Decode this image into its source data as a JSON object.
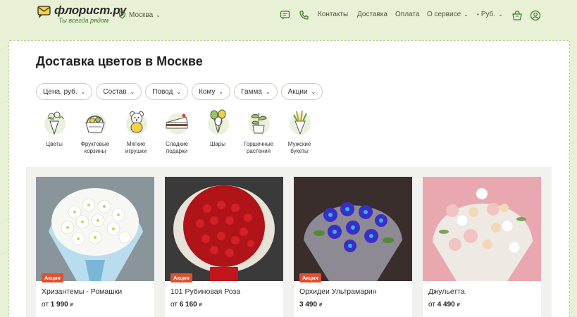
{
  "header": {
    "logo_name": "флорист.ру",
    "logo_tagline": "Ты всегда рядом",
    "city": "Москва",
    "nav": [
      "Контакты",
      "Доставка",
      "Оплата",
      "О сервисе"
    ],
    "currency": "Руб."
  },
  "page_title": "Доставка цветов в Москве",
  "filters": [
    "Цена, руб.",
    "Состав",
    "Повод",
    "Кому",
    "Гамма",
    "Акции"
  ],
  "categories": [
    {
      "label": "Цветы",
      "icon": "bouquet-icon"
    },
    {
      "label": "Фруктовые корзины",
      "icon": "fruit-basket-icon"
    },
    {
      "label": "Мягкие игрушки",
      "icon": "teddy-bear-icon"
    },
    {
      "label": "Сладкие подарки",
      "icon": "cake-icon"
    },
    {
      "label": "Шары",
      "icon": "balloons-icon"
    },
    {
      "label": "Горшечные растения",
      "icon": "potted-plant-icon"
    },
    {
      "label": "Мужские букеты",
      "icon": "mens-bouquet-icon"
    }
  ],
  "products": [
    {
      "name": "Хризантемы - Ромашки",
      "price_prefix": "от",
      "price": "1 990",
      "currency_sign": "₽",
      "badge": "Акция",
      "color": "#ffffff"
    },
    {
      "name": "101 Рубиновая Роза",
      "price_prefix": "от",
      "price": "6 160",
      "currency_sign": "₽",
      "badge": "Акция",
      "color": "#c0161c"
    },
    {
      "name": "Орхидеи Ультрамарин",
      "price_prefix": "",
      "price": "3 490",
      "currency_sign": "₽",
      "badge": "Акция",
      "color": "#3a2ec9"
    },
    {
      "name": "Джульетта",
      "price_prefix": "от",
      "price": "4 490",
      "currency_sign": "₽",
      "badge": "",
      "color": "#f0c8c8"
    }
  ],
  "colors": {
    "accent": "#3e7f2a",
    "background": "#e8f0d6",
    "badge": "#e0512f"
  }
}
